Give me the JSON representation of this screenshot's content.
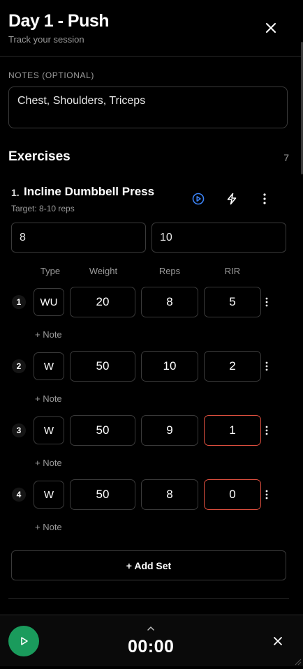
{
  "header": {
    "title": "Day 1 - Push",
    "subtitle": "Track your session"
  },
  "notes": {
    "label": "NOTES (OPTIONAL)",
    "value": "Chest, Shoulders, Triceps"
  },
  "exercises_section": {
    "title": "Exercises",
    "count": "7"
  },
  "exercise": {
    "number": "1.",
    "name": "Incline Dumbbell Press",
    "target": "Target: 8-10 reps",
    "rep_min": "8",
    "rep_max": "10",
    "columns": [
      "Type",
      "Weight",
      "Reps",
      "RIR"
    ],
    "sets": [
      {
        "num": "1",
        "type": "WU",
        "weight": "20",
        "reps": "8",
        "rir": "5",
        "rir_flag": false,
        "note": "+ Note"
      },
      {
        "num": "2",
        "type": "W",
        "weight": "50",
        "reps": "10",
        "rir": "2",
        "rir_flag": false,
        "note": "+ Note"
      },
      {
        "num": "3",
        "type": "W",
        "weight": "50",
        "reps": "9",
        "rir": "1",
        "rir_flag": true,
        "note": "+ Note"
      },
      {
        "num": "4",
        "type": "W",
        "weight": "50",
        "reps": "8",
        "rir": "0",
        "rir_flag": true,
        "note": "+ Note"
      }
    ],
    "add_set_label": "+ Add Set",
    "icons": [
      "play-circle-icon",
      "lightning-icon",
      "more-vertical-icon"
    ]
  },
  "footer": {
    "timer": "00:00"
  },
  "colors": {
    "accent_green": "#1a9b5c",
    "accent_blue": "#3b82f6",
    "warning_red": "#e0503f",
    "background": "#000000"
  }
}
